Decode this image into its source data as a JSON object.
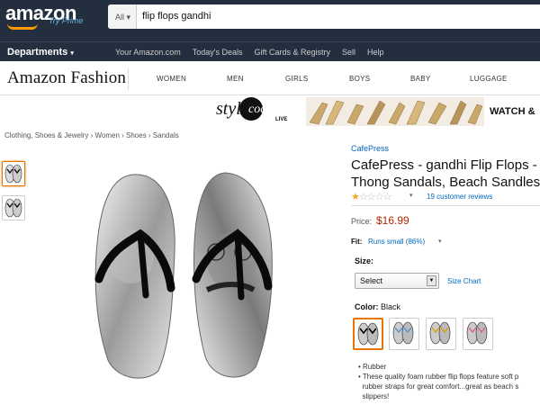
{
  "header": {
    "logo": "amazon",
    "prime": "Try Prime",
    "search_category": "All",
    "search_query": "flip flops gandhi",
    "departments": "Departments",
    "nav_links": [
      "Your Amazon.com",
      "Today's Deals",
      "Gift Cards & Registry",
      "Sell",
      "Help"
    ]
  },
  "fashion": {
    "logo": "Amazon Fashion",
    "categories": [
      "WOMEN",
      "MEN",
      "GIRLS",
      "BOYS",
      "BABY",
      "LUGGAGE"
    ]
  },
  "banner": {
    "style": "style",
    "code": "code",
    "live": "LIVE",
    "cta": "WATCH &"
  },
  "breadcrumb": "Clothing, Shoes & Jewelry › Women › Shoes › Sandals",
  "product": {
    "brand": "CafePress",
    "title_line1": "CafePress - gandhi Flip Flops - F",
    "title_line2": "Thong Sandals, Beach Sandles",
    "rating": 1,
    "rating_max": 5,
    "reviews": "19 customer reviews",
    "price_label": "Price:",
    "price": "$16.99",
    "fit_label": "Fit:",
    "fit_value": "Runs small (86%)",
    "size_label": "Size:",
    "size_select": "Select",
    "size_chart": "Size Chart",
    "color_label": "Color:",
    "color_value": "Black",
    "bullets": [
      "Rubber",
      "These quality foam rubber flip flops feature soft p",
      "rubber straps for great comfort...great as beach s",
      "slippers!"
    ]
  },
  "colors": {
    "header_bg": "#232f3e",
    "accent_orange": "#ff9900",
    "link_blue": "#0066c0",
    "price_red": "#b12704",
    "selected_border": "#e77600"
  }
}
